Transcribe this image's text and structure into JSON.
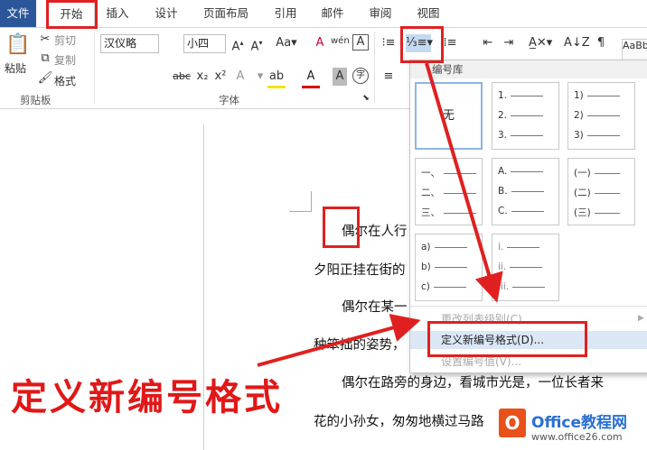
{
  "tabs": [
    {
      "label": "文件"
    },
    {
      "label": "开始"
    },
    {
      "label": "插入"
    },
    {
      "label": "设计"
    },
    {
      "label": "页面布局"
    },
    {
      "label": "引用"
    },
    {
      "label": "邮件"
    },
    {
      "label": "审阅"
    },
    {
      "label": "视图"
    }
  ],
  "ribbon": {
    "clipboard": {
      "paste": "粘贴",
      "cut": "剪切",
      "copy": "复制",
      "format_painter": "格式",
      "group": "剪贴板"
    },
    "font": {
      "font_name": "汉仪略",
      "font_size": "小四",
      "group": "字体"
    },
    "styles_preview": "AaBb"
  },
  "document": {
    "lines": [
      "偶尔在人行",
      "夕阳正挂在街的",
      "偶尔在某一",
      "种笨拙的姿势，",
      "偶尔在路旁的身边，看城市光是，一位长者来",
      "花的小孙女，匆匆地横过马路"
    ]
  },
  "dropdown": {
    "header": "编号库",
    "none_label": "无",
    "cells": [
      {
        "markers": [
          "1.",
          "2.",
          "3."
        ]
      },
      {
        "markers": [
          "1)",
          "2)",
          "3)"
        ]
      },
      {
        "markers": [
          "一、",
          "二、",
          "三、"
        ]
      },
      {
        "markers": [
          "A.",
          "B.",
          "C."
        ]
      },
      {
        "markers": [
          "(一)",
          "(二)",
          "(三)"
        ]
      },
      {
        "markers": [
          "a)",
          "b)",
          "c)"
        ]
      },
      {
        "markers": [
          "i.",
          "ii.",
          "iii."
        ]
      }
    ],
    "menu": {
      "change_level": "更改列表级别(C)",
      "define_new": "定义新编号格式(D)...",
      "set_value": "设置编号值(V)..."
    }
  },
  "annotation": {
    "caption": "定义新编号格式"
  },
  "watermark": {
    "brand": "Office教程网",
    "url": "www.office26.com"
  },
  "colors": {
    "accent": "#2b579a",
    "annotation_red": "#e02020"
  }
}
